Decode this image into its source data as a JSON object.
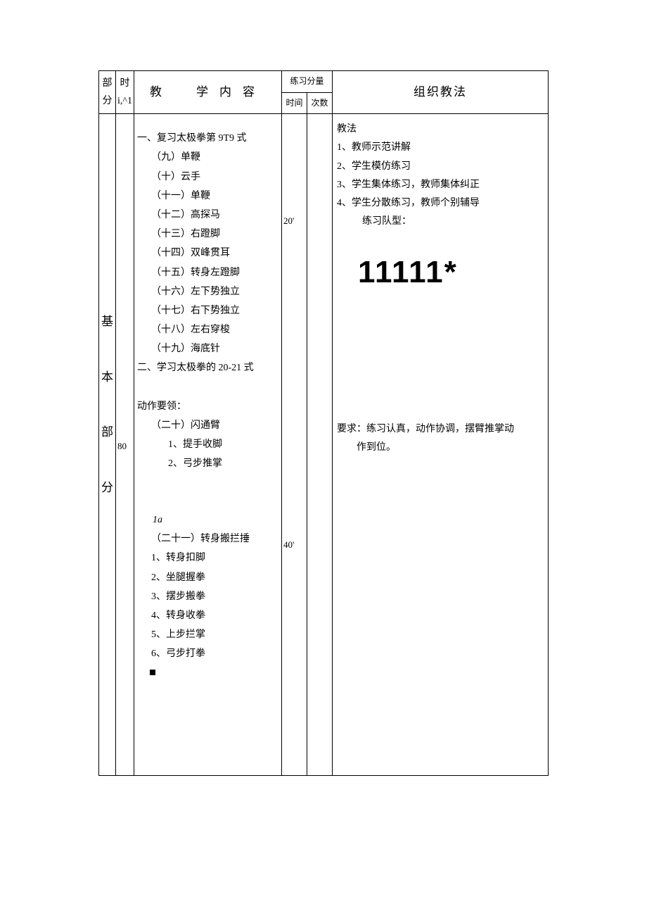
{
  "headers": {
    "part": "部分",
    "time_outer1": "时",
    "time_outer2": "i,^1",
    "content": "教　学内容",
    "practice_amount": "练习分量",
    "practice_time": "时间",
    "practice_count": "次数",
    "method": "组织教法"
  },
  "body": {
    "part_chars": [
      "基",
      "本",
      "部",
      "分"
    ],
    "time_outer_val": "80",
    "content": {
      "section1_title": "一、复习太极拳第 9T9 式",
      "moves1": [
        "（九）单鞭",
        "（十）云手",
        "（十一）单鞭",
        "（十二）高探马",
        "（十三）右蹬脚",
        "（十四）双峰贯耳",
        "（十五）转身左蹬脚",
        "（十六）左下势独立",
        "（十七）右下势独立",
        "（十八）左右穿梭",
        "（十九）海底针"
      ],
      "section2_title": "二、学习太极拳的 20-21 式",
      "action_label": "动作要领：",
      "move20_title": "（二十）闪通臂",
      "move20_steps": [
        "1、提手收脚",
        "2、弓步推掌"
      ],
      "note_1a": "1a",
      "move21_title": "（二十一）转身搬拦捶",
      "move21_steps": [
        "1、转身扣脚",
        "2、坐腿握拳",
        "3、摆步搬拳",
        "4、转身收拳",
        "5、上步拦掌",
        "6、弓步打拳"
      ]
    },
    "practice_time": {
      "t1": "20'",
      "t2": "40'"
    },
    "method": {
      "teaching_label": "教法",
      "teaching_steps": [
        "1、教师示范讲解",
        "2、学生模仿练习",
        "3、学生集体练习，教师集体纠正",
        "4、学生分散练习，教师个别辅导"
      ],
      "formation_label": "练习队型：",
      "formation_text": "11111*",
      "requirement_line1": "要求：练习认真，动作协调，摆臂推掌动",
      "requirement_line2": "作到位。"
    }
  }
}
